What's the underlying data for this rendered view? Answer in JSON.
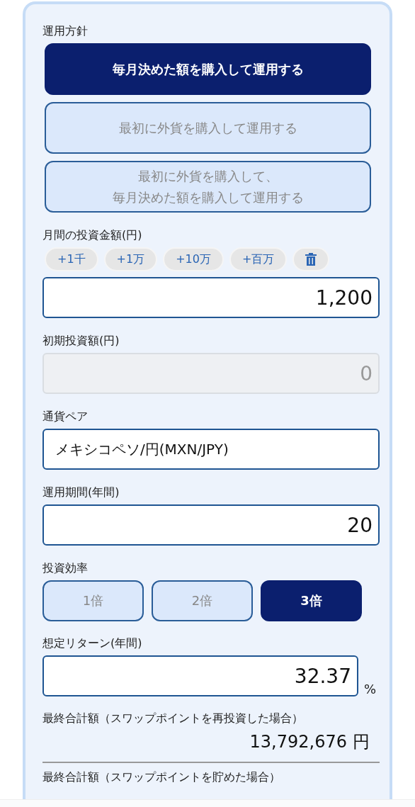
{
  "policy": {
    "label": "運用方針",
    "options": [
      {
        "lines": [
          "毎月決めた額を購入して運用する"
        ],
        "selected": true
      },
      {
        "lines": [
          "最初に外貨を購入して運用する"
        ],
        "selected": false
      },
      {
        "lines": [
          "最初に外貨を購入して、",
          "毎月決めた額を購入して運用する"
        ],
        "selected": false
      }
    ]
  },
  "monthly": {
    "label": "月間の投資金額(円)",
    "chips": [
      {
        "kind": "text",
        "label": "+1千"
      },
      {
        "kind": "text",
        "label": "+1万"
      },
      {
        "kind": "text",
        "label": "+10万"
      },
      {
        "kind": "text",
        "label": "+百万"
      },
      {
        "kind": "trash"
      }
    ],
    "value": "1,200"
  },
  "initial": {
    "label": "初期投資額(円)",
    "value": "0",
    "disabled": true
  },
  "pair": {
    "label": "通貨ペア",
    "value": "メキシコペソ/円(MXN/JPY)"
  },
  "period": {
    "label": "運用期間(年間)",
    "value": "20"
  },
  "leverage": {
    "label": "投資効率",
    "options": [
      {
        "label": "1倍",
        "selected": false
      },
      {
        "label": "2倍",
        "selected": false
      },
      {
        "label": "3倍",
        "selected": true
      }
    ]
  },
  "expected_return": {
    "label": "想定リターン(年間)",
    "value": "32.37",
    "unit": "%"
  },
  "total_reinvested": {
    "label": "最終合計額（スワップポイントを再投資した場合）",
    "value": "13,792,676",
    "unit": "円"
  },
  "total_saved": {
    "label": "最終合計額（スワップポイントを貯めた場合）"
  }
}
